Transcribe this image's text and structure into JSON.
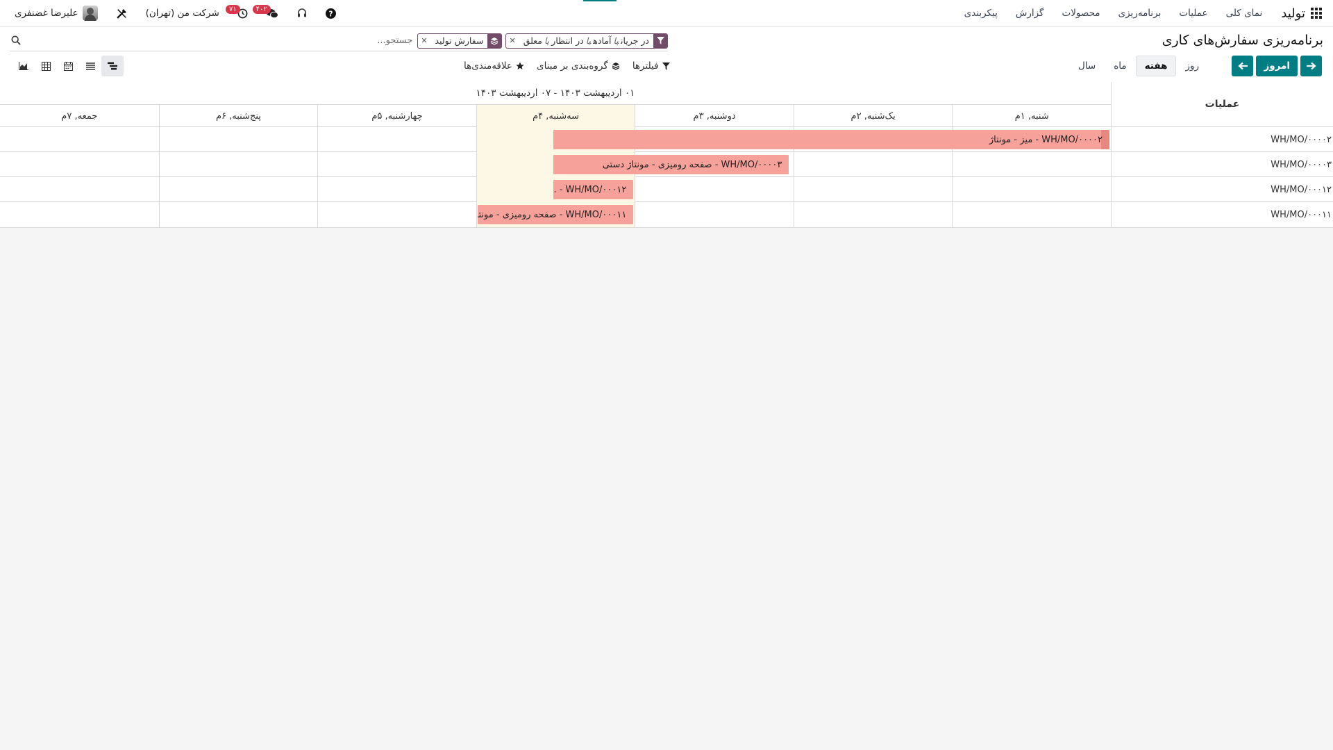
{
  "navbar": {
    "brand": "تولید",
    "menu": [
      "نمای کلی",
      "عملیات",
      "برنامه‌ریزی",
      "محصولات",
      "گزارش",
      "پیکربندی"
    ],
    "company": "شرکت من (تهران)",
    "user": "علیرضا غضنفری",
    "activity_badge": "۷۱",
    "messages_badge": "۴۰۲"
  },
  "control": {
    "title": "برنامه‌ریزی سفارش‌های کاری",
    "facets": [
      {
        "type": "filter",
        "parts": [
          "در جریان",
          "آماده",
          "در انتظار",
          "معلق"
        ],
        "separator": "یا"
      },
      {
        "type": "groupby",
        "label": "سفارش تولید"
      }
    ],
    "search_placeholder": "جستجو...",
    "today_label": "امروز",
    "scales": [
      "روز",
      "هفته",
      "ماه",
      "سال"
    ],
    "active_scale": "هفته",
    "filters_label": "فیلترها",
    "groupby_label": "گروه‌بندی بر مبنای",
    "favorites_label": "علاقه‌مندی‌ها"
  },
  "gantt": {
    "side_header": "عملیات",
    "range": "۰۱ اردیبهشت ۱۴۰۳ - ۰۷ اردیبهشت ۱۴۰۳",
    "days": [
      "شنبه, ۱م",
      "یک‌شنبه, ۲م",
      "دوشنبه, ۳م",
      "سه‌شنبه, ۴م",
      "چهارشنبه, ۵م",
      "پنج‌شنبه, ۶م",
      "جمعه, ۷م"
    ],
    "today_index": 3,
    "rows": [
      {
        "label": "WH/MO/۰۰۰۰۲",
        "pill": "WH/MO/۰۰۰۰۲ - میز - مونتاژ",
        "start_day": 0,
        "end_day": 3.52,
        "mark": true
      },
      {
        "label": "WH/MO/۰۰۰۰۳",
        "pill": "WH/MO/۰۰۰۰۳ - صفحه رومیزی - مونتاژ دستی",
        "start_day": 2.02,
        "end_day": 3.52,
        "mark": false
      },
      {
        "label": "WH/MO/۰۰۰۱۲",
        "pill": "WH/MO/۰۰۰۱۲ - ...",
        "start_day": 3.0,
        "end_day": 3.52,
        "mark": false
      },
      {
        "label": "WH/MO/۰۰۰۱۱",
        "pill": "WH/MO/۰۰۰۱۱ - صفحه رومیزی - مونتا...",
        "start_day": 3.0,
        "end_day": 4.0,
        "mark": false
      }
    ]
  }
}
